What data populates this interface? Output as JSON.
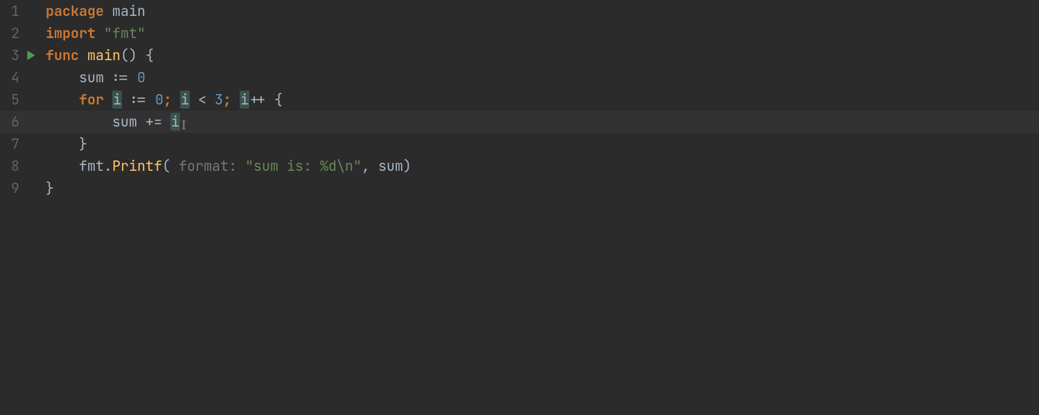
{
  "editor": {
    "language": "go",
    "highlighted_variable": "i",
    "current_line": 6,
    "line_numbers": [
      "1",
      "2",
      "3",
      "4",
      "5",
      "6",
      "7",
      "8",
      "9"
    ],
    "run_gutter_line": 3,
    "lines": {
      "l1": {
        "kw": "package",
        "sp": " ",
        "name": "main"
      },
      "l2": {
        "kw": "import",
        "sp": " ",
        "str": "\"fmt\""
      },
      "l3": {
        "kw": "func",
        "sp": " ",
        "name": "main",
        "tail": "() {"
      },
      "l4": {
        "indent": "    ",
        "lhs": "sum ",
        "op": ":= ",
        "num": "0"
      },
      "l5": {
        "indent": "    ",
        "kw": "for",
        "sp": " ",
        "v1": "i",
        "seg1": " := ",
        "n0": "0",
        "semi1": ";",
        "sp2": " ",
        "v2": "i",
        "seg2": " < ",
        "n1": "3",
        "semi2": ";",
        "sp3": " ",
        "v3": "i",
        "tail": "++ {"
      },
      "l6": {
        "indent": "        ",
        "seg1": "sum += ",
        "v": "i"
      },
      "l7": {
        "indent": "    ",
        "brace": "}"
      },
      "l8": {
        "indent": "    ",
        "obj": "fmt",
        "dot": ".",
        "call": "Printf",
        "open": "(",
        "sphint": " ",
        "hint": "format:",
        "sp2": " ",
        "str": "\"sum is: %d\\n\"",
        "rest": ", sum)"
      },
      "l9": {
        "brace": "}"
      }
    }
  },
  "colors": {
    "background": "#2b2b2b",
    "current_line": "#323232",
    "gutter_text": "#606366",
    "default_text": "#a9b7c6",
    "keyword": "#cc7832",
    "function": "#ffc66d",
    "number": "#6897bb",
    "string": "#6a8759",
    "hint": "#787878",
    "var_highlight_bg": "#3b514d",
    "run_icon": "#499c54"
  }
}
